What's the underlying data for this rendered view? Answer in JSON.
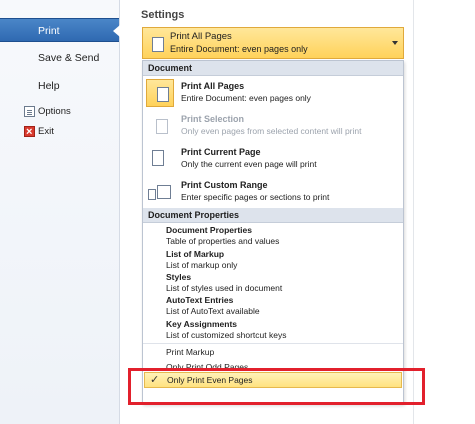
{
  "nav": {
    "print": "Print",
    "save_send": "Save & Send",
    "help": "Help",
    "options": "Options",
    "exit": "Exit"
  },
  "settings": {
    "title": "Settings",
    "combo_title": "Print All Pages",
    "combo_subtitle": "Entire Document: even pages only"
  },
  "dropdown": {
    "document_header": "Document",
    "options": [
      {
        "title": "Print All Pages",
        "subtitle": "Entire Document: even pages only"
      },
      {
        "title": "Print Selection",
        "subtitle": "Only even pages from selected content will print"
      },
      {
        "title": "Print Current Page",
        "subtitle": "Only the current even page will print"
      },
      {
        "title": "Print Custom Range",
        "subtitle": "Enter specific pages or sections to print"
      }
    ],
    "properties_header": "Document Properties",
    "properties": [
      {
        "title": "Document Properties",
        "subtitle": "Table of properties and values"
      },
      {
        "title": "List of Markup",
        "subtitle": "List of markup only"
      },
      {
        "title": "Styles",
        "subtitle": "List of styles used in document"
      },
      {
        "title": "AutoText Entries",
        "subtitle": "List of AutoText available"
      },
      {
        "title": "Key Assignments",
        "subtitle": "List of customized shortcut keys"
      }
    ],
    "print_markup": "Print Markup",
    "only_odd": "Only Print Odd Pages",
    "only_even": "Only Print Even Pages",
    "check_mark": "✓"
  },
  "colors": {
    "nav_active": "#2f69b1",
    "selected": "#ffd25a",
    "annotation": "#e2202c"
  }
}
